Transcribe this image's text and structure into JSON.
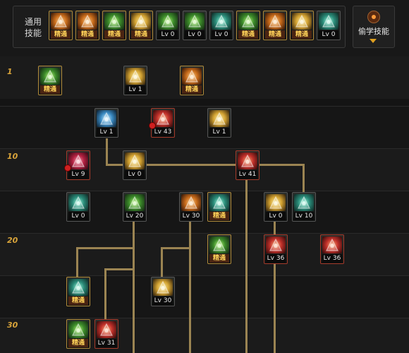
{
  "top": {
    "common_skills_label": "通用\n技能",
    "steal_skill_label": "偷学技能",
    "common_slots": [
      {
        "icon": "pose-skill-icon",
        "color": "orange",
        "badge": "精通",
        "master": true
      },
      {
        "icon": "leap-skill-icon",
        "color": "orange",
        "badge": "精通",
        "master": true
      },
      {
        "icon": "run-skill-icon",
        "color": "green",
        "badge": "精通",
        "master": true
      },
      {
        "icon": "wings-skill-icon",
        "color": "gold",
        "badge": "精通",
        "master": true
      },
      {
        "icon": "target-skill-icon",
        "color": "green",
        "badge": "Lv 0",
        "master": false
      },
      {
        "icon": "crosshair-skill-icon",
        "color": "green",
        "badge": "Lv 0",
        "master": false
      },
      {
        "icon": "kneel-skill-icon",
        "color": "teal",
        "badge": "Lv 0",
        "master": false
      },
      {
        "icon": "figure-skill-icon",
        "color": "green",
        "badge": "精通",
        "master": true
      },
      {
        "icon": "eye-skill-icon",
        "color": "orange",
        "badge": "精通",
        "master": true
      },
      {
        "icon": "muscle-skill-icon",
        "color": "gold",
        "badge": "精通",
        "master": true
      },
      {
        "icon": "dagger-skill-icon",
        "color": "teal",
        "badge": "Lv 0",
        "master": false
      }
    ]
  },
  "levels": [
    "1",
    "10",
    "20",
    "30"
  ],
  "tree_slots": [
    {
      "icon": "bear-skill-icon",
      "color": "green",
      "badge": "精通",
      "master": true,
      "warn": false
    },
    {
      "icon": "dash-skill-icon",
      "color": "gold",
      "badge": "Lv 1",
      "master": false,
      "warn": false
    },
    {
      "icon": "slash-skill-icon",
      "color": "orange",
      "badge": "精通",
      "master": true,
      "warn": false
    },
    {
      "icon": "sword-skill-icon",
      "color": "blue",
      "badge": "Lv 1",
      "master": false,
      "warn": false
    },
    {
      "icon": "whirl-skill-icon",
      "color": "red",
      "badge": "Lv 43",
      "master": false,
      "warn": true
    },
    {
      "icon": "crescent-skill-icon",
      "color": "gold",
      "badge": "Lv 1",
      "master": false,
      "warn": false
    },
    {
      "icon": "ankh-skill-icon",
      "color": "crimson",
      "badge": "Lv 9",
      "master": false,
      "warn": true
    },
    {
      "icon": "claw-skill-icon",
      "color": "gold",
      "badge": "Lv 0",
      "master": false,
      "warn": false
    },
    {
      "icon": "fire-fist-skill-icon",
      "color": "red",
      "badge": "Lv 41",
      "master": false,
      "warn": false
    },
    {
      "icon": "mask-skill-icon",
      "color": "teal",
      "badge": "Lv 0",
      "master": false,
      "warn": false
    },
    {
      "icon": "cycle-skill-icon",
      "color": "green",
      "badge": "Lv 20",
      "master": false,
      "warn": false
    },
    {
      "icon": "arc-slash-skill-icon",
      "color": "orange",
      "badge": "Lv 30",
      "master": false,
      "warn": false
    },
    {
      "icon": "storm-skill-icon",
      "color": "teal",
      "badge": "精通",
      "master": true,
      "warn": false
    },
    {
      "icon": "hourglass-skill-icon",
      "color": "gold",
      "badge": "Lv 0",
      "master": false,
      "warn": false
    },
    {
      "icon": "wing-blade-skill-icon",
      "color": "teal",
      "badge": "Lv 10",
      "master": false,
      "warn": false
    },
    {
      "icon": "bow-skill-icon",
      "color": "green",
      "badge": "精通",
      "master": true,
      "warn": false
    },
    {
      "icon": "burst-skill-icon",
      "color": "red",
      "badge": "Lv 36",
      "master": false,
      "warn": false
    },
    {
      "icon": "vortex-skill-icon",
      "color": "red",
      "badge": "Lv 36",
      "master": false,
      "warn": false
    },
    {
      "icon": "skull-skill-icon",
      "color": "teal",
      "badge": "精通",
      "master": true,
      "warn": false
    },
    {
      "icon": "spin-kick-skill-icon",
      "color": "gold",
      "badge": "Lv 30",
      "master": false,
      "warn": false
    },
    {
      "icon": "stance-skill-icon",
      "color": "green",
      "badge": "精通",
      "master": true,
      "warn": false
    },
    {
      "icon": "explosion-skill-icon",
      "color": "red",
      "badge": "Lv 31",
      "master": false,
      "warn": false
    }
  ]
}
